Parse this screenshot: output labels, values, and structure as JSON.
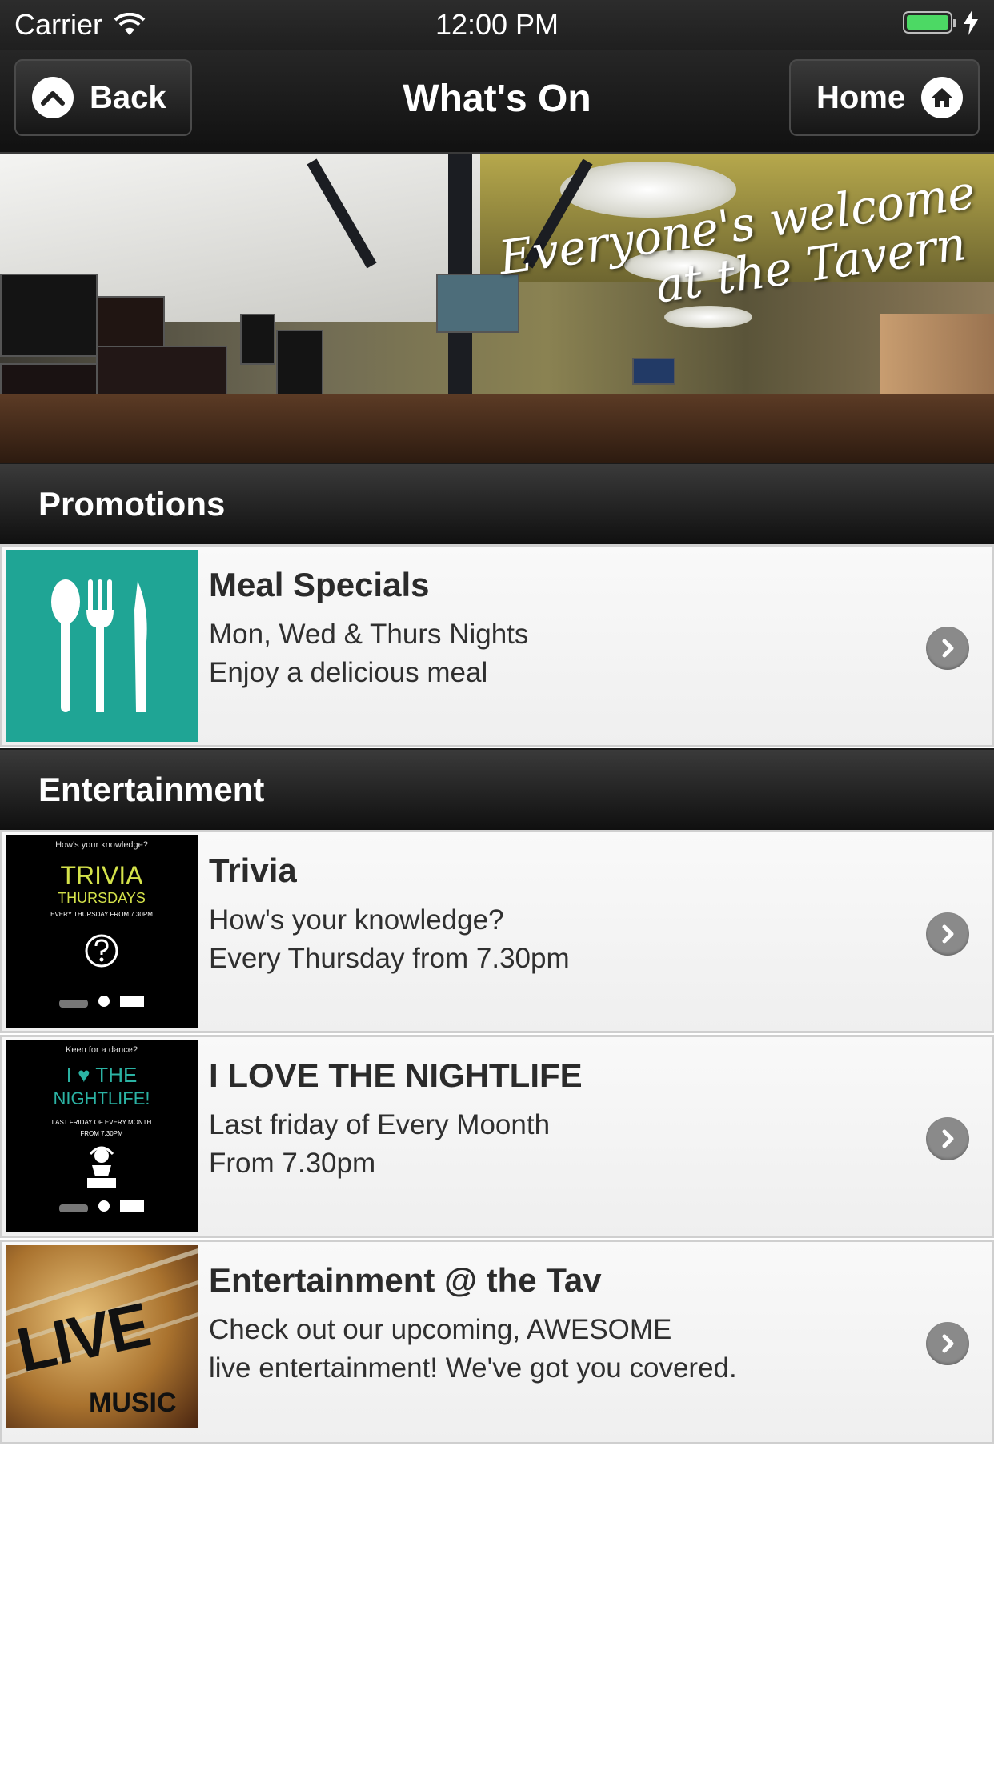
{
  "status_bar": {
    "carrier": "Carrier",
    "time": "12:00 PM"
  },
  "nav": {
    "title": "What's On",
    "back_label": "Back",
    "home_label": "Home"
  },
  "banner": {
    "line1": "Everyone's welcome",
    "line2": "at the Tavern"
  },
  "sections": [
    {
      "title": "Promotions"
    },
    {
      "title": "Entertainment"
    }
  ],
  "items": [
    {
      "title": "Meal Specials",
      "line1": "Mon, Wed & Thurs Nights",
      "line2": "Enjoy a delicious meal"
    },
    {
      "title": "Trivia",
      "line1": "How's your knowledge?",
      "line2": "Every Thursday from 7.30pm"
    },
    {
      "title": "I LOVE THE NIGHTLIFE",
      "line1": "Last friday of Every Moonth",
      "line2": "From 7.30pm"
    },
    {
      "title": "Entertainment @ the Tav",
      "line1": "Check out our upcoming, AWESOME",
      "line2": "live entertainment! We've got you covered."
    }
  ],
  "posters": {
    "trivia": {
      "top": "How's your knowledge?",
      "big1": "TRIVIA",
      "big2": "THURSDAYS",
      "sub": "EVERY THURSDAY FROM 7.30PM"
    },
    "nightlife": {
      "top": "Keen for a dance?",
      "big1": "I ♥ THE",
      "big2": "NIGHTLIFE!",
      "sub1": "LAST FRIDAY OF EVERY MONTH",
      "sub2": "FROM 7.30PM"
    },
    "live": {
      "big1": "LIVE",
      "big2": "MUSIC"
    }
  },
  "colors": {
    "meal_tile": "#1fa595",
    "poster_accent": "#d4e24a",
    "poster_teal": "#2bb3a4"
  },
  "icons": [
    "wifi-icon",
    "battery-icon",
    "charging-icon",
    "chevron-up-icon",
    "home-icon",
    "cutlery-icon",
    "chevron-right-icon",
    "question-icon"
  ]
}
